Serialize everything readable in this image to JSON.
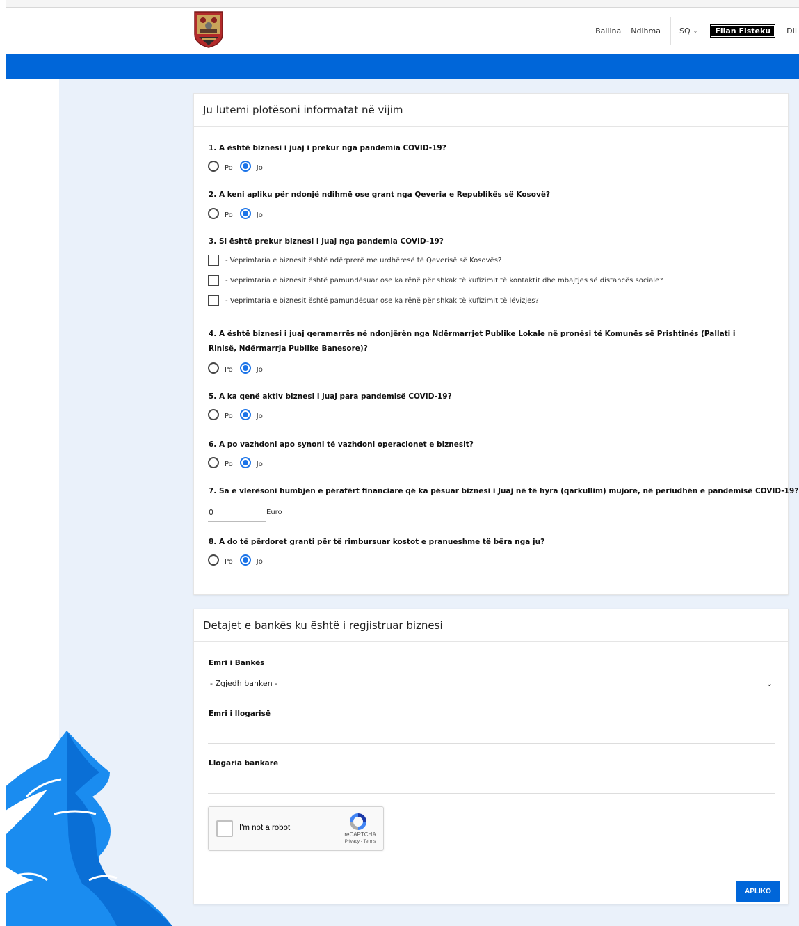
{
  "header": {
    "nav": {
      "home": "Ballina",
      "help": "Ndihma",
      "language": "SQ",
      "user": "Filan Fisteku",
      "logout": "DIL"
    }
  },
  "form": {
    "title": "Ju lutemi plotësoni informatat në vijim",
    "yes_label": "Po",
    "no_label": "Jo",
    "questions": [
      {
        "text": "1. A është biznesi i juaj i prekur nga pandemia COVID-19?",
        "selected": "Jo"
      },
      {
        "text": "2. A keni apliku për ndonjë ndihmë ose grant nga Qeveria e Republikës së Kosovë?",
        "selected": "Jo"
      },
      {
        "text": "3. Si është prekur biznesi i Juaj nga pandemia COVID-19?"
      },
      {
        "text": "4. A është biznesi i juaj qeramarrës në ndonjërën nga Ndërmarrjet Publike Lokale në pronësi të Komunës së Prishtinës (Pallati i Rinisë, Ndërmarrja Publike Banesore)?",
        "selected": "Jo"
      },
      {
        "text": "5. A ka qenë aktiv biznesi i juaj para pandemisë COVID-19?",
        "selected": "Jo"
      },
      {
        "text": "6. A po vazhdoni apo synoni të vazhdoni operacionet e biznesit?",
        "selected": "Jo"
      },
      {
        "text": "7. Sa e vlerësoni humbjen e përafërt financiare që ka pësuar biznesi i Juaj në të hyra (qarkullim) mujore, në periudhën e pandemisë COVID-19?",
        "value": "0",
        "unit": "Euro"
      },
      {
        "text": "8. A do të përdoret granti për të rimbursuar kostot e pranueshme të bëra nga ju?",
        "selected": "Jo"
      }
    ],
    "impact_options": [
      {
        "label": "- Veprimtaria e biznesit është ndërprerë me urdhëresë të Qeverisë së Kosovës?",
        "checked": false
      },
      {
        "label": "- Veprimtaria e biznesit është pamundësuar ose ka rënë për shkak të kufizimit të kontaktit dhe mbajtjes së distancës sociale?",
        "checked": false
      },
      {
        "label": "- Veprimtaria e biznesit është pamundësuar ose ka rënë për shkak të kufizimit të lëvizjes?",
        "checked": false
      }
    ]
  },
  "bank": {
    "title": "Detajet e bankës ku është i regjistruar biznesi",
    "bank_name_label": "Emri i Bankës",
    "bank_select_value": "- Zgjedh banken -",
    "account_name_label": "Emri i llogarisë",
    "account_name_value": "",
    "account_number_label": "Llogaria bankare",
    "account_number_value": ""
  },
  "captcha": {
    "label": "I'm not a robot",
    "brand": "reCAPTCHA",
    "links": "Privacy - Terms"
  },
  "actions": {
    "apply": "APLIKO"
  },
  "colors": {
    "accent": "#0066d9",
    "radio_selected": "#1a73e8"
  }
}
